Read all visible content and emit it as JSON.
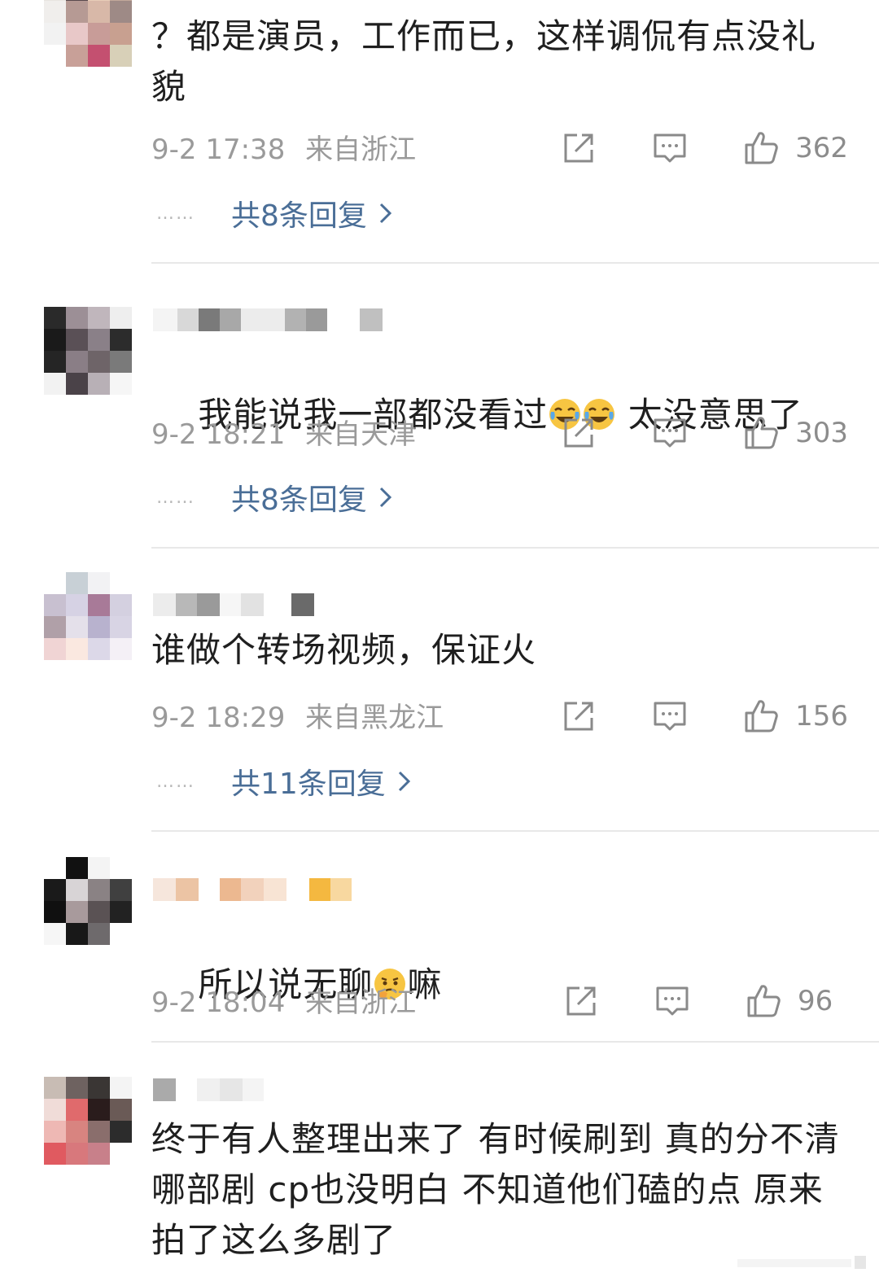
{
  "comments": [
    {
      "text": "？都是演员，工作而已，这样调侃有点没礼貌",
      "time": "9-2 17:38",
      "location": "来自浙江",
      "likes": "362",
      "replies": "共8条回复"
    },
    {
      "text_before": "我能说我一部都没看过",
      "text_after": " 太没意思了",
      "time": "9-2 18:21",
      "location": "来自天津",
      "likes": "303",
      "replies": "共8条回复"
    },
    {
      "text": "谁做个转场视频，保证火",
      "time": "9-2 18:29",
      "location": "来自黑龙江",
      "likes": "156",
      "replies": "共11条回复"
    },
    {
      "text_before": "所以说无聊",
      "text_after": "嘛",
      "time": "9-2 18:04",
      "location": "来自浙江",
      "likes": "96"
    },
    {
      "text": "终于有人整理出来了 有时候刷到 真的分不清哪部剧 cp也没明白 不知道他们磕的点 原来拍了这么多剧了"
    }
  ],
  "icons": {
    "share": "share-icon",
    "comment": "comment-icon",
    "like": "thumbs-up-icon",
    "chevron": "chevron-right-icon",
    "emoji_cry": "laugh-cry-emoji-icon",
    "emoji_think": "thinking-emoji-icon"
  },
  "colors": {
    "reply_link": "#4a6e97",
    "meta_text": "#9a9a9a"
  }
}
